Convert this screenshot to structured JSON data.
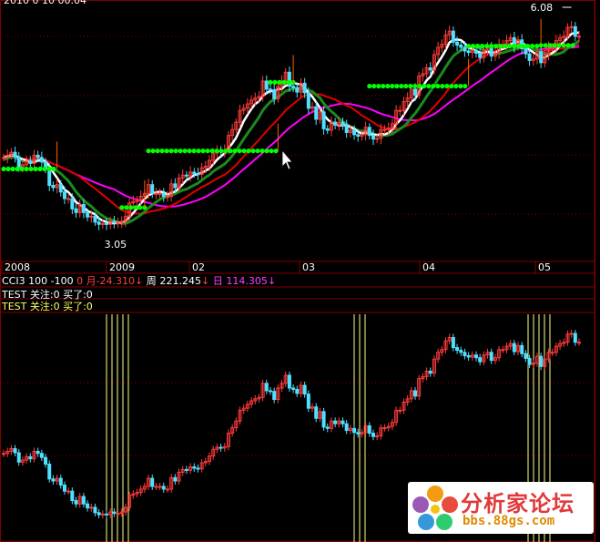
{
  "main_panel": {
    "top_clip_text": "2010 0 10 00.04",
    "price_high_label": "6.08",
    "price_low_label": "3.05",
    "date_labels": [
      "2008",
      "2009",
      "02",
      "03",
      "04",
      "05"
    ]
  },
  "indicator_bar": {
    "cci_name": "CCI3",
    "cci_params": "100  -100",
    "cci_zero": "0",
    "month_label": "月",
    "month_value": "-24.310",
    "month_arrow": "↓",
    "week_label": "周",
    "week_value": "221.245",
    "week_arrow": "↓",
    "day_label": "日",
    "day_value": "114.305",
    "day_arrow": "↓",
    "test1": "TEST 关注:0 买了:0",
    "test2": "TEST 关注:0 买了:0"
  },
  "watermark": {
    "text": "分析家论坛",
    "url": "bbs.88gs.com"
  },
  "colors": {
    "up": "#ff3b3b",
    "down": "#50e0ff",
    "support": "#00ff00",
    "ma_white": "#ffffff",
    "ma_red": "#e00000",
    "ma_magenta": "#ff00ff",
    "ma_green": "#1c8a1c",
    "separator": "#800000",
    "vertical_line": "#ffff80"
  },
  "chart_data": {
    "type": "candlestick",
    "title": "",
    "xlabel": "",
    "ylabel": "",
    "x": [
      "2008",
      "2009",
      "02",
      "03",
      "04",
      "05"
    ],
    "ylim": [
      3.0,
      6.15
    ],
    "price_high": 6.08,
    "price_low": 3.05,
    "grid": "horizontal dotted",
    "series": [
      {
        "values": [
          4.18,
          4.21,
          4.25,
          4.19,
          4.05,
          4.08,
          4.13,
          4.1,
          4.21,
          4.18,
          4.12,
          4.02,
          3.8,
          3.77,
          3.81,
          3.71,
          3.62,
          3.62,
          3.48,
          3.43,
          3.54,
          3.43,
          3.37,
          3.38,
          3.3,
          3.27,
          3.28,
          3.27,
          3.31,
          3.29,
          3.29,
          3.31,
          3.38,
          3.56,
          3.58,
          3.6,
          3.65,
          3.69,
          3.81,
          3.69,
          3.69,
          3.69,
          3.65,
          3.65,
          3.82,
          3.77,
          3.9,
          3.94,
          3.93,
          3.98,
          3.96,
          3.95,
          4.04,
          4.06,
          4.14,
          4.24,
          4.27,
          4.26,
          4.28,
          4.48,
          4.56,
          4.66,
          4.82,
          4.85,
          4.91,
          4.96,
          4.99,
          5.01,
          5.22,
          5.11,
          5.1,
          4.98,
          5.15,
          5.22,
          5.34,
          5.15,
          5.13,
          5.07,
          5.19,
          5.06,
          4.85,
          4.87,
          4.7,
          4.8,
          4.57,
          4.55,
          4.66,
          4.62,
          4.66,
          4.62,
          4.52,
          4.55,
          4.49,
          4.47,
          4.49,
          4.59,
          4.48,
          4.43,
          4.44,
          4.56,
          4.56,
          4.58,
          4.64,
          4.82,
          4.82,
          4.94,
          4.99,
          5.11,
          5.03,
          5.29,
          5.32,
          5.4,
          5.37,
          5.58,
          5.68,
          5.72,
          5.85,
          5.9,
          5.75,
          5.71,
          5.68,
          5.63,
          5.61,
          5.64,
          5.6,
          5.54,
          5.64,
          5.68,
          5.56,
          5.6,
          5.72,
          5.72,
          5.77,
          5.81,
          5.69,
          5.78,
          5.66,
          5.59,
          5.5,
          5.52,
          5.62,
          5.47,
          5.58,
          5.68,
          5.68,
          5.77,
          5.81,
          5.83,
          5.95,
          5.96,
          5.83,
          5.83
        ]
      }
    ]
  }
}
